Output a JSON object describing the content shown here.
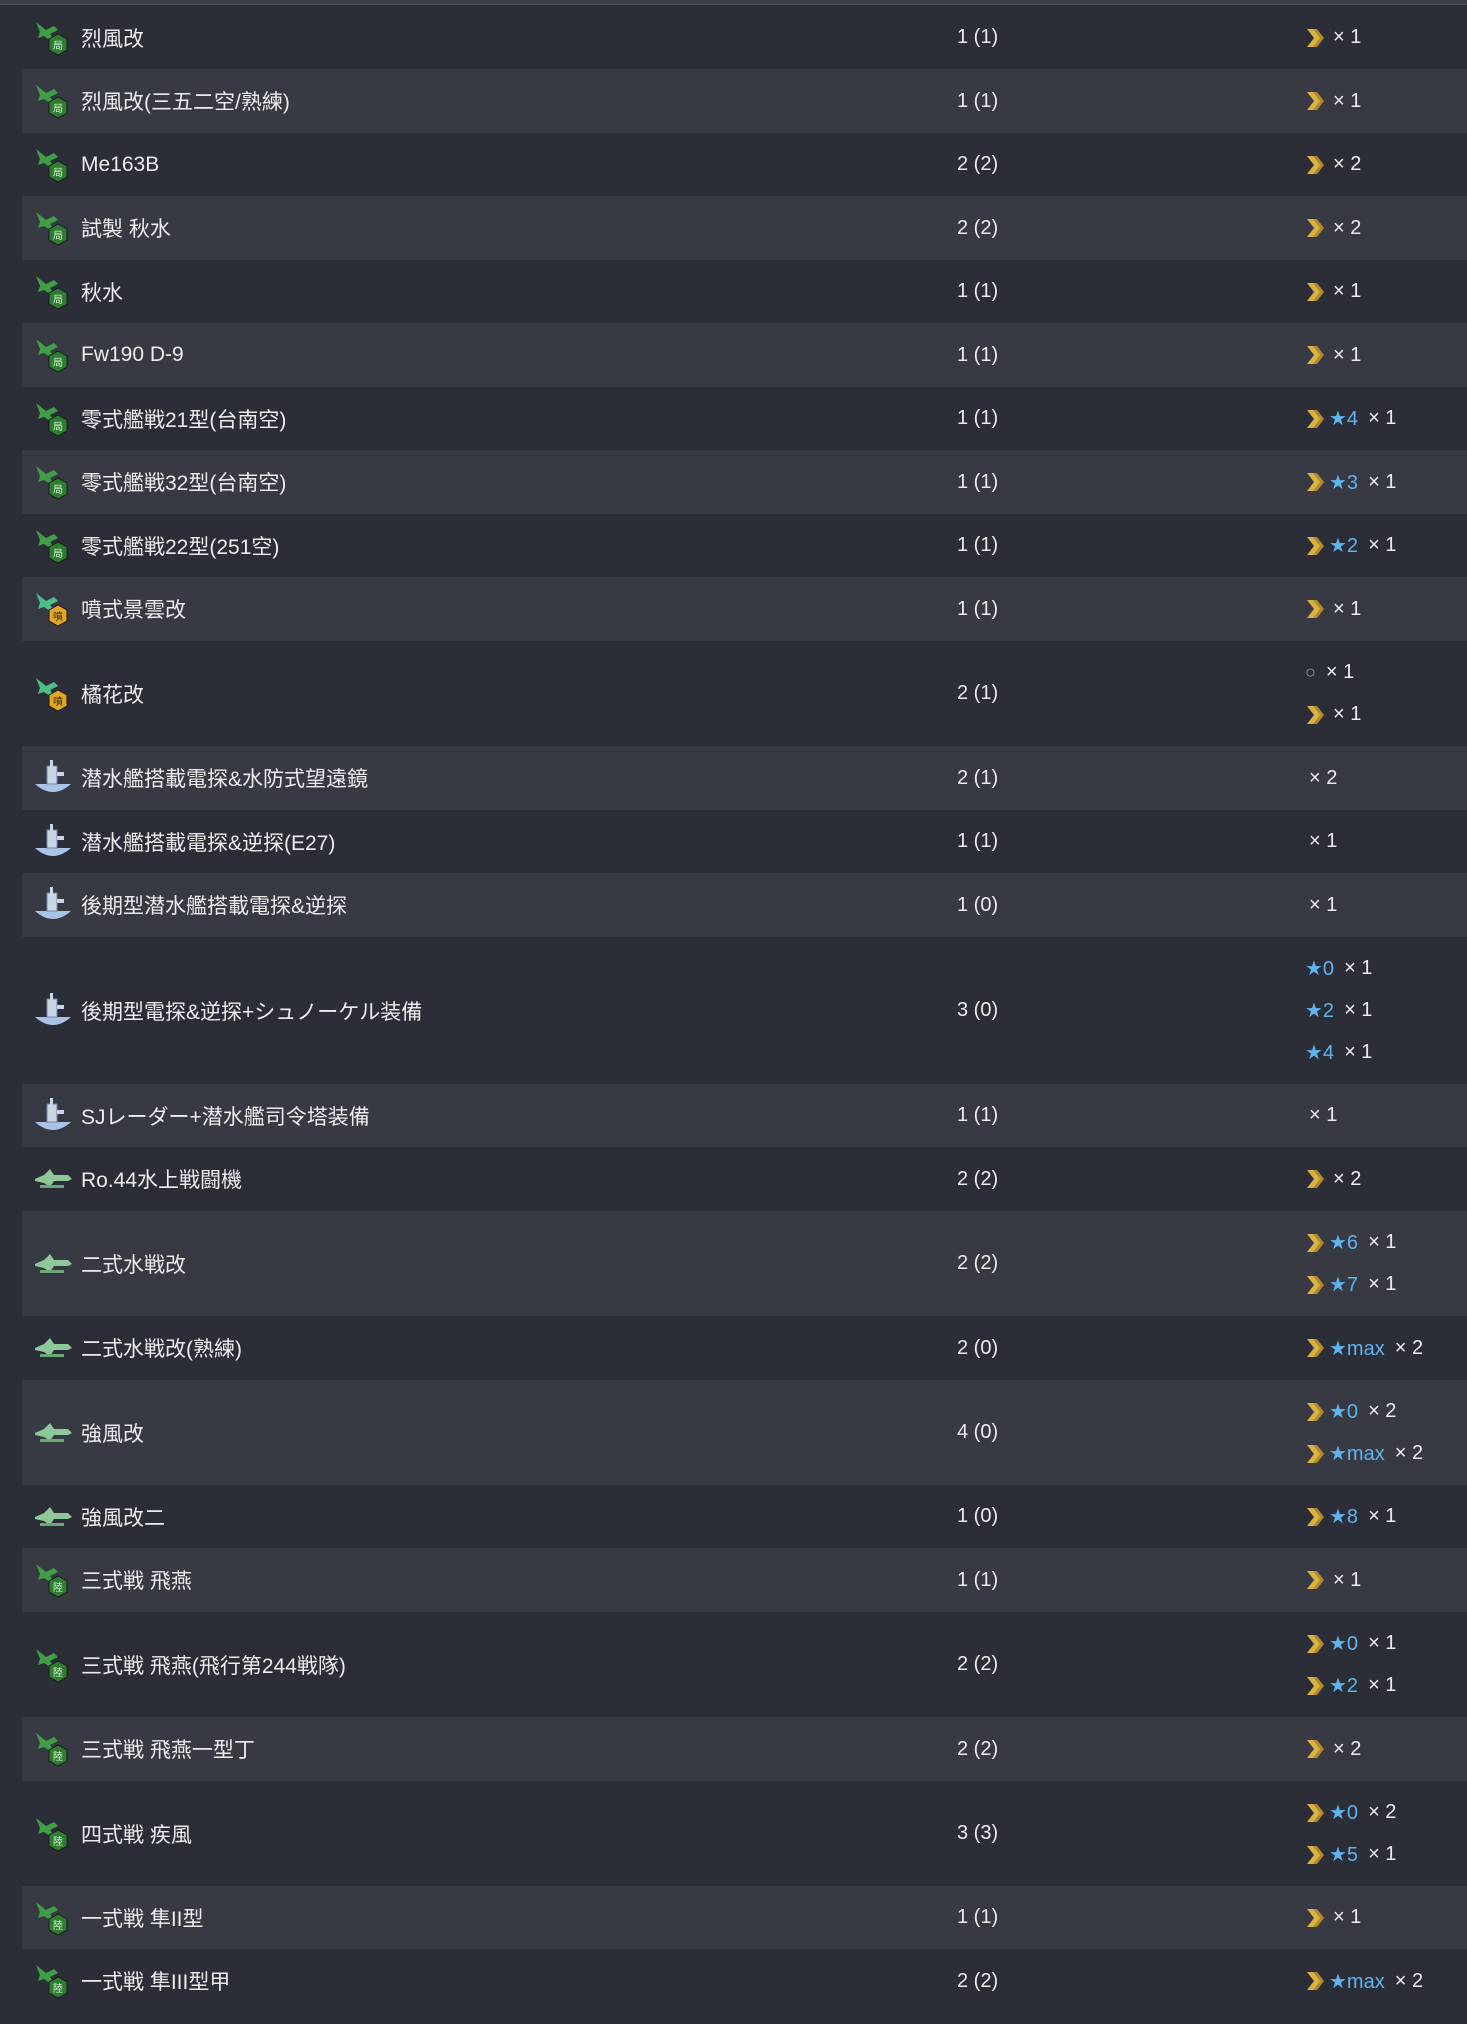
{
  "rows": [
    {
      "name": "烈風改",
      "count": "1 (1)",
      "icon": "army-fighter-icon",
      "h": 63,
      "prof": [
        {
          "chev": true,
          "star": "",
          "mult": "× 1"
        }
      ]
    },
    {
      "name": "烈風改(三五二空/熟練)",
      "count": "1 (1)",
      "icon": "army-fighter-icon",
      "h": 64,
      "prof": [
        {
          "chev": true,
          "star": "",
          "mult": "× 1"
        }
      ]
    },
    {
      "name": "Me163B",
      "count": "2 (2)",
      "icon": "army-fighter-icon",
      "h": 63,
      "prof": [
        {
          "chev": true,
          "star": "",
          "mult": "× 2"
        }
      ]
    },
    {
      "name": "試製 秋水",
      "count": "2 (2)",
      "icon": "army-fighter-icon",
      "h": 64,
      "prof": [
        {
          "chev": true,
          "star": "",
          "mult": "× 2"
        }
      ]
    },
    {
      "name": "秋水",
      "count": "1 (1)",
      "icon": "army-fighter-icon",
      "h": 63,
      "prof": [
        {
          "chev": true,
          "star": "",
          "mult": "× 1"
        }
      ]
    },
    {
      "name": "Fw190 D-9",
      "count": "1 (1)",
      "icon": "army-fighter-icon",
      "h": 64,
      "prof": [
        {
          "chev": true,
          "star": "",
          "mult": "× 1"
        }
      ]
    },
    {
      "name": "零式艦戦21型(台南空)",
      "count": "1 (1)",
      "icon": "army-fighter-icon",
      "h": 63,
      "prof": [
        {
          "chev": true,
          "star": "★4",
          "mult": "× 1"
        }
      ]
    },
    {
      "name": "零式艦戦32型(台南空)",
      "count": "1 (1)",
      "icon": "army-fighter-icon",
      "h": 64,
      "prof": [
        {
          "chev": true,
          "star": "★3",
          "mult": "× 1"
        }
      ]
    },
    {
      "name": "零式艦戦22型(251空)",
      "count": "1 (1)",
      "icon": "army-fighter-icon",
      "h": 63,
      "prof": [
        {
          "chev": true,
          "star": "★2",
          "mult": "× 1"
        }
      ]
    },
    {
      "name": "噴式景雲改",
      "count": "1 (1)",
      "icon": "jet-icon",
      "h": 64,
      "prof": [
        {
          "chev": true,
          "star": "",
          "mult": "× 1"
        }
      ]
    },
    {
      "name": "橘花改",
      "count": "2 (1)",
      "icon": "jet-icon",
      "h": 105,
      "prof": [
        {
          "ring": "○",
          "chev": false,
          "star": "",
          "mult": "× 1"
        },
        {
          "chev": true,
          "star": "",
          "mult": "× 1"
        }
      ]
    },
    {
      "name": "潜水艦搭載電探&水防式望遠鏡",
      "count": "2 (1)",
      "icon": "submarine-equipment-icon",
      "h": 64,
      "prof": [
        {
          "chev": false,
          "star": "",
          "mult": "× 2"
        }
      ]
    },
    {
      "name": "潜水艦搭載電探&逆探(E27)",
      "count": "1 (1)",
      "icon": "submarine-equipment-icon",
      "h": 63,
      "prof": [
        {
          "chev": false,
          "star": "",
          "mult": "× 1"
        }
      ]
    },
    {
      "name": "後期型潜水艦搭載電探&逆探",
      "count": "1 (0)",
      "icon": "submarine-equipment-icon",
      "h": 64,
      "prof": [
        {
          "chev": false,
          "star": "",
          "mult": "× 1"
        }
      ]
    },
    {
      "name": "後期型電探&逆探+シュノーケル装備",
      "count": "3 (0)",
      "icon": "submarine-equipment-icon",
      "h": 147,
      "prof": [
        {
          "chev": false,
          "star": "★0",
          "mult": "× 1"
        },
        {
          "chev": false,
          "star": "★2",
          "mult": "× 1"
        },
        {
          "chev": false,
          "star": "★4",
          "mult": "× 1"
        }
      ]
    },
    {
      "name": "SJレーダー+潜水艦司令塔装備",
      "count": "1 (1)",
      "icon": "submarine-equipment-icon",
      "h": 63,
      "prof": [
        {
          "chev": false,
          "star": "",
          "mult": "× 1"
        }
      ]
    },
    {
      "name": "Ro.44水上戦闘機",
      "count": "2 (2)",
      "icon": "seaplane-fighter-icon",
      "h": 64,
      "prof": [
        {
          "chev": true,
          "star": "",
          "mult": "× 2"
        }
      ]
    },
    {
      "name": "二式水戦改",
      "count": "2 (2)",
      "icon": "seaplane-fighter-icon",
      "h": 105,
      "prof": [
        {
          "chev": true,
          "star": "★6",
          "mult": "× 1"
        },
        {
          "chev": true,
          "star": "★7",
          "mult": "× 1"
        }
      ]
    },
    {
      "name": "二式水戦改(熟練)",
      "count": "2 (0)",
      "icon": "seaplane-fighter-icon",
      "h": 64,
      "prof": [
        {
          "chev": true,
          "star": "★max",
          "mult": "× 2"
        }
      ]
    },
    {
      "name": "強風改",
      "count": "4 (0)",
      "icon": "seaplane-fighter-icon",
      "h": 105,
      "prof": [
        {
          "chev": true,
          "star": "★0",
          "mult": "× 2"
        },
        {
          "chev": true,
          "star": "★max",
          "mult": "× 2"
        }
      ]
    },
    {
      "name": "強風改二",
      "count": "1 (0)",
      "icon": "seaplane-fighter-icon",
      "h": 63,
      "prof": [
        {
          "chev": true,
          "star": "★8",
          "mult": "× 1"
        }
      ]
    },
    {
      "name": "三式戦 飛燕",
      "count": "1 (1)",
      "icon": "land-fighter-icon",
      "h": 64,
      "prof": [
        {
          "chev": true,
          "star": "",
          "mult": "× 1"
        }
      ]
    },
    {
      "name": "三式戦 飛燕(飛行第244戦隊)",
      "count": "2 (2)",
      "icon": "land-fighter-icon",
      "h": 105,
      "prof": [
        {
          "chev": true,
          "star": "★0",
          "mult": "× 1"
        },
        {
          "chev": true,
          "star": "★2",
          "mult": "× 1"
        }
      ]
    },
    {
      "name": "三式戦 飛燕一型丁",
      "count": "2 (2)",
      "icon": "land-fighter-icon",
      "h": 64,
      "prof": [
        {
          "chev": true,
          "star": "",
          "mult": "× 2"
        }
      ]
    },
    {
      "name": "四式戦 疾風",
      "count": "3 (3)",
      "icon": "land-fighter-icon",
      "h": 105,
      "prof": [
        {
          "chev": true,
          "star": "★0",
          "mult": "× 2"
        },
        {
          "chev": true,
          "star": "★5",
          "mult": "× 1"
        }
      ]
    },
    {
      "name": "一式戦 隼II型",
      "count": "1 (1)",
      "icon": "land-fighter-icon",
      "h": 63,
      "prof": [
        {
          "chev": true,
          "star": "",
          "mult": "× 1"
        }
      ]
    },
    {
      "name": "一式戦 隼III型甲",
      "count": "2 (2)",
      "icon": "land-fighter-icon",
      "h": 64,
      "prof": [
        {
          "chev": true,
          "star": "★max",
          "mult": "× 2"
        }
      ]
    }
  ],
  "icon_badges": {
    "army-fighter-icon": "局",
    "jet-icon": "噴",
    "land-fighter-icon": "陸"
  },
  "colors": {
    "chevron": "#d9b244",
    "star": "#5fb4f0",
    "plane_green": "#3f9e46",
    "badge_green": "#2e7d32",
    "badge_jet": "#e2a526",
    "seaplane": "#8ec89a",
    "sub": "#a9c4e6"
  }
}
